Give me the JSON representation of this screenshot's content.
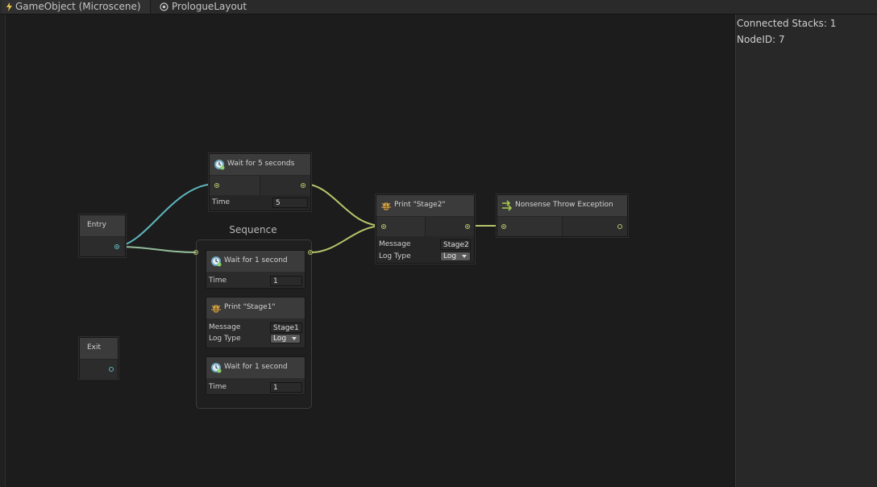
{
  "header": {
    "breadcrumb_1": "GameObject (Microscene)",
    "breadcrumb_2": "PrologueLayout"
  },
  "inspector": {
    "connected_stacks": "Connected Stacks: 1",
    "node_id": "NodeID: 7"
  },
  "nodes": {
    "entry": {
      "title": "Entry"
    },
    "exit": {
      "title": "Exit"
    },
    "wait5": {
      "title": "Wait for 5 seconds",
      "time_label": "Time",
      "time_value": "5"
    },
    "sequence": {
      "title": "Sequence",
      "wait1a": {
        "title": "Wait for 1 second",
        "time_label": "Time",
        "time_value": "1"
      },
      "print1": {
        "title": "Print \"Stage1\"",
        "message_label": "Message",
        "message_value": "Stage1",
        "logtype_label": "Log Type",
        "logtype_value": "Log"
      },
      "wait1b": {
        "title": "Wait for 1 second",
        "time_label": "Time",
        "time_value": "1"
      }
    },
    "print2": {
      "title": "Print \"Stage2\"",
      "message_label": "Message",
      "message_value": "Stage2",
      "logtype_label": "Log Type",
      "logtype_value": "Log"
    },
    "nonsense": {
      "title": "Nonsense Throw Exception"
    }
  },
  "colors": {
    "wire_yellow": "#b8c46a",
    "wire_teal": "#5fb7c0"
  },
  "icons": {
    "breadcrumb_1": "lightning-icon",
    "breadcrumb_2": "target-icon",
    "wait": "clock-icon",
    "print": "bug-icon",
    "nonsense": "arrows-right-icon"
  }
}
